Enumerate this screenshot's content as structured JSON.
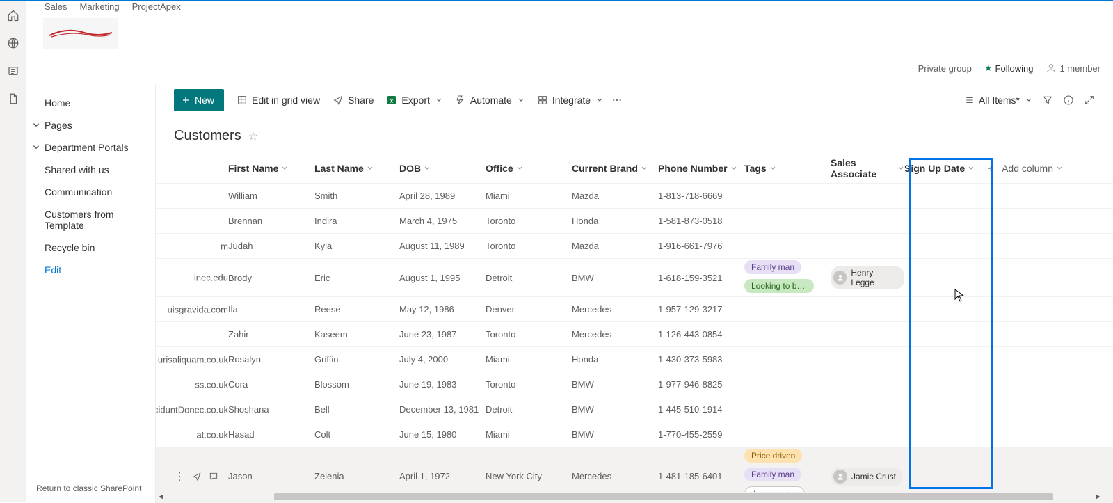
{
  "site_tabs": {
    "t0": "Sales",
    "t1": "Marketing",
    "t2": "ProjectApex"
  },
  "group_info": {
    "privacy": "Private group",
    "following": "Following",
    "members": "1 member"
  },
  "commands": {
    "new": "New",
    "edit_grid": "Edit in grid view",
    "share": "Share",
    "export": "Export",
    "automate": "Automate",
    "integrate": "Integrate",
    "view_label": "All Items*"
  },
  "nav": {
    "home": "Home",
    "pages": "Pages",
    "dept": "Department Portals",
    "shared": "Shared with us",
    "comm": "Communication",
    "cust_tmpl": "Customers from Template",
    "recycle": "Recycle bin",
    "edit": "Edit",
    "return": "Return to classic SharePoint"
  },
  "list": {
    "title": "Customers",
    "columns": {
      "first": "First Name",
      "last": "Last Name",
      "dob": "DOB",
      "office": "Office",
      "brand": "Current Brand",
      "phone": "Phone Number",
      "tags": "Tags",
      "assoc": "Sales Associate",
      "signup": "Sign Up Date",
      "add": "Add column"
    },
    "rows": [
      {
        "email": "",
        "first": "William",
        "last": "Smith",
        "dob": "April 28, 1989",
        "office": "Miami",
        "brand": "Mazda",
        "phone": "1-813-718-6669",
        "tags": [],
        "assoc": ""
      },
      {
        "email": "",
        "first": "Brennan",
        "last": "Indira",
        "dob": "March 4, 1975",
        "office": "Toronto",
        "brand": "Honda",
        "phone": "1-581-873-0518",
        "tags": [],
        "assoc": ""
      },
      {
        "email": "m",
        "first": "Judah",
        "last": "Kyla",
        "dob": "August 11, 1989",
        "office": "Toronto",
        "brand": "Mazda",
        "phone": "1-916-661-7976",
        "tags": [],
        "assoc": ""
      },
      {
        "email": "inec.edu",
        "first": "Brody",
        "last": "Eric",
        "dob": "August 1, 1995",
        "office": "Detroit",
        "brand": "BMW",
        "phone": "1-618-159-3521",
        "tags": [
          "Family man",
          "Looking to buy s…"
        ],
        "assoc": "Henry Legge"
      },
      {
        "email": "uisgravida.com",
        "first": "Ila",
        "last": "Reese",
        "dob": "May 12, 1986",
        "office": "Denver",
        "brand": "Mercedes",
        "phone": "1-957-129-3217",
        "tags": [],
        "assoc": ""
      },
      {
        "email": "",
        "first": "Zahir",
        "last": "Kaseem",
        "dob": "June 23, 1987",
        "office": "Toronto",
        "brand": "Mercedes",
        "phone": "1-126-443-0854",
        "tags": [],
        "assoc": ""
      },
      {
        "email": "urisaliquam.co.uk",
        "first": "Rosalyn",
        "last": "Griffin",
        "dob": "July 4, 2000",
        "office": "Miami",
        "brand": "Honda",
        "phone": "1-430-373-5983",
        "tags": [],
        "assoc": ""
      },
      {
        "email": "ss.co.uk",
        "first": "Cora",
        "last": "Blossom",
        "dob": "June 19, 1983",
        "office": "Toronto",
        "brand": "BMW",
        "phone": "1-977-946-8825",
        "tags": [],
        "assoc": ""
      },
      {
        "email": "cinciduntDonec.co.uk",
        "first": "Shoshana",
        "last": "Bell",
        "dob": "December 13, 1981",
        "office": "Detroit",
        "brand": "BMW",
        "phone": "1-445-510-1914",
        "tags": [],
        "assoc": ""
      },
      {
        "email": "at.co.uk",
        "first": "Hasad",
        "last": "Colt",
        "dob": "June 15, 1980",
        "office": "Miami",
        "brand": "BMW",
        "phone": "1-770-455-2559",
        "tags": [],
        "assoc": ""
      },
      {
        "email": "",
        "first": "Jason",
        "last": "Zelenia",
        "dob": "April 1, 1972",
        "office": "New York City",
        "brand": "Mercedes",
        "phone": "1-481-185-6401",
        "tags": [
          "Price driven",
          "Family man",
          "Accessories"
        ],
        "assoc": "Jamie Crust"
      }
    ]
  },
  "tag_colors": {
    "Family man": "tag-purple",
    "Looking to buy s…": "tag-green",
    "Price driven": "tag-orange",
    "Accessories": "tag-outline"
  }
}
